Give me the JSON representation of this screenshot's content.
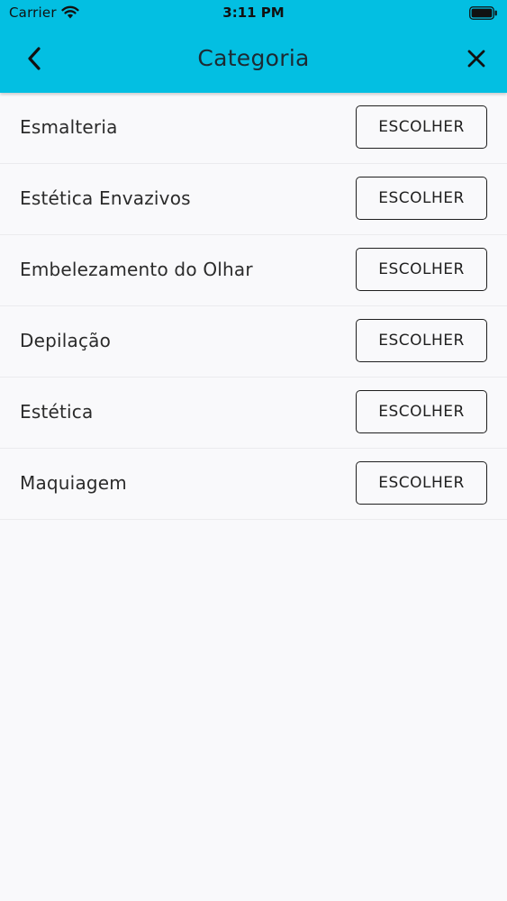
{
  "status_bar": {
    "carrier": "Carrier",
    "time": "3:11 PM"
  },
  "header": {
    "title": "Categoria",
    "back_icon": "chevron-left-icon",
    "close_icon": "close-icon",
    "color": "#03bfe2"
  },
  "categories": [
    {
      "label": "Esmalteria",
      "button": "ESCOLHER"
    },
    {
      "label": "Estética Envazivos",
      "button": "ESCOLHER"
    },
    {
      "label": "Embelezamento do Olhar",
      "button": "ESCOLHER"
    },
    {
      "label": "Depilação",
      "button": "ESCOLHER"
    },
    {
      "label": "Estética",
      "button": "ESCOLHER"
    },
    {
      "label": "Maquiagem",
      "button": "ESCOLHER"
    }
  ]
}
